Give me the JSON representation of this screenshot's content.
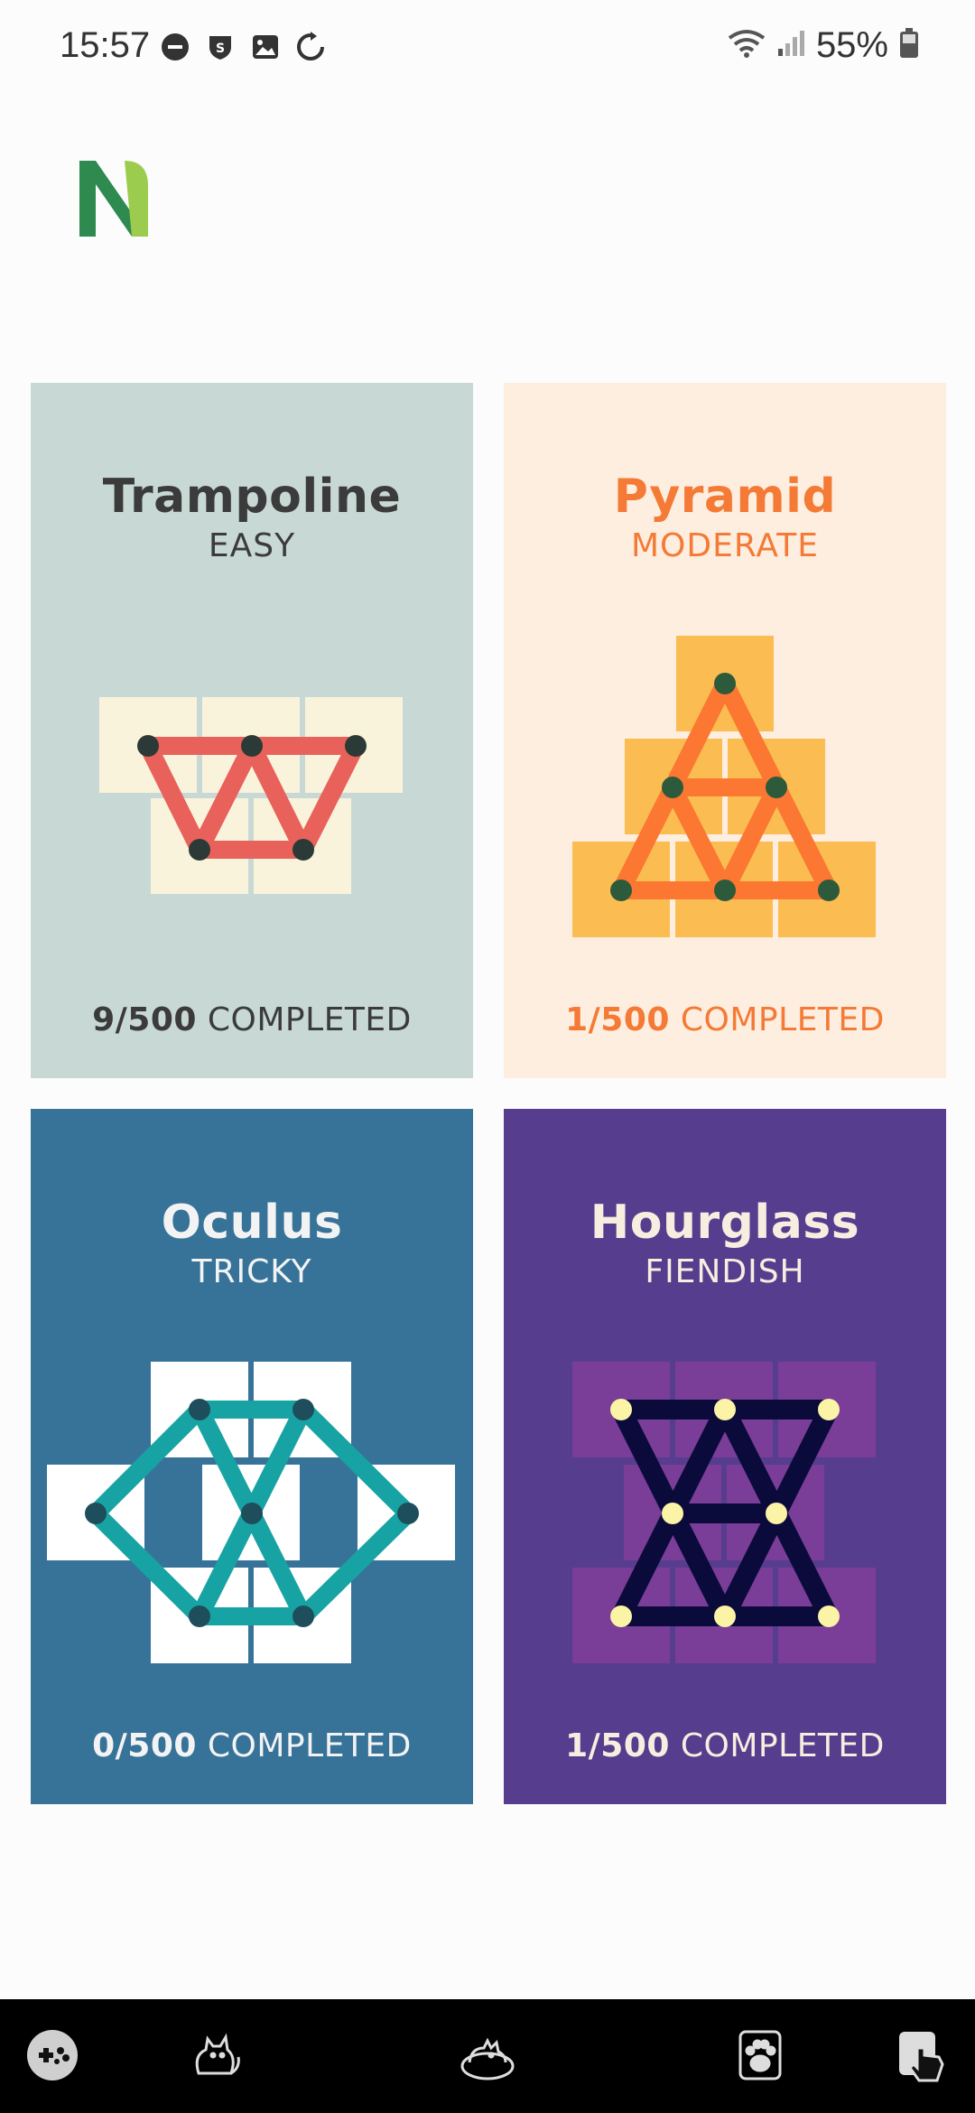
{
  "status_bar": {
    "time": "15:57",
    "battery": "55%"
  },
  "cards": [
    {
      "title": "Trampoline",
      "difficulty": "EASY",
      "count": "9/500",
      "completed_label": "COMPLETED",
      "bg": "#c8d9d5",
      "title_color": "#3b3b3b",
      "sub_color": "#3b3b3b"
    },
    {
      "title": "Pyramid",
      "difficulty": "MODERATE",
      "count": "1/500",
      "completed_label": "COMPLETED",
      "bg": "#fdeee0",
      "title_color": "#f47a35",
      "sub_color": "#f47a35"
    },
    {
      "title": "Oculus",
      "difficulty": "TRICKY",
      "count": "0/500",
      "completed_label": "COMPLETED",
      "bg": "#377399",
      "title_color": "#f3f3f3",
      "sub_color": "#f3f3f3"
    },
    {
      "title": "Hourglass",
      "difficulty": "FIENDISH",
      "count": "1/500",
      "completed_label": "COMPLETED",
      "bg": "#573d8e",
      "title_color": "#f7eee0",
      "sub_color": "#f7eee0"
    }
  ],
  "nav": [
    "gamepad-icon",
    "cat-icon",
    "cat-bed-icon",
    "paw-icon",
    "hand-tap-icon"
  ]
}
